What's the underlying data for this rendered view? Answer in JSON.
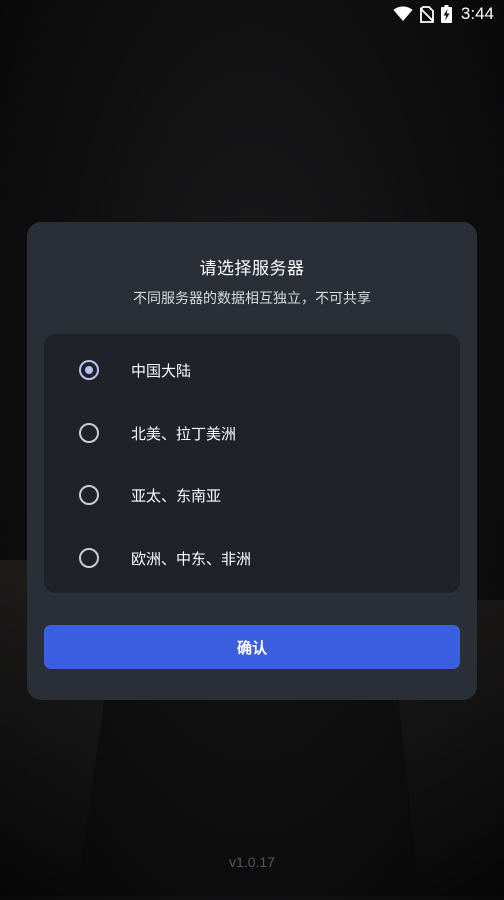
{
  "status_bar": {
    "time": "3:44",
    "icons": [
      "wifi-icon",
      "no-sim-icon",
      "battery-charging-icon"
    ]
  },
  "dialog": {
    "title": "请选择服务器",
    "subtitle": "不同服务器的数据相互独立，不可共享",
    "options": [
      {
        "label": "中国大陆",
        "selected": true
      },
      {
        "label": "北美、拉丁美洲",
        "selected": false
      },
      {
        "label": "亚太、东南亚",
        "selected": false
      },
      {
        "label": "欧洲、中东、非洲",
        "selected": false
      }
    ],
    "confirm_label": "确认"
  },
  "version": "v1.0.17",
  "colors": {
    "dialog_bg": "#2a2e36",
    "panel_bg": "#1f2229",
    "accent": "#3b5fe0",
    "radio_selected": "#b7c3ee"
  }
}
